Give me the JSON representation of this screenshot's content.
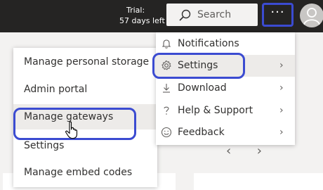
{
  "topbar": {
    "trial_line1": "Trial:",
    "trial_line2": "57 days left",
    "search_label": "Search",
    "more_label": "···"
  },
  "right_menu": {
    "items": [
      {
        "label": "Notifications",
        "icon": "bell-icon",
        "chevron": ""
      },
      {
        "label": "Settings",
        "icon": "gear-icon",
        "chevron": "›"
      },
      {
        "label": "Download",
        "icon": "download-icon",
        "chevron": "›"
      },
      {
        "label": "Help & Support",
        "icon": "question-icon",
        "chevron": "›"
      },
      {
        "label": "Feedback",
        "icon": "smiley-icon",
        "chevron": "›"
      }
    ]
  },
  "left_menu": {
    "items": [
      {
        "label": "Manage personal storage"
      },
      {
        "label": "Admin portal"
      },
      {
        "label": "Manage gateways"
      },
      {
        "label": "Settings"
      },
      {
        "label": "Manage embed codes"
      }
    ]
  },
  "nav": {
    "prev": "‹",
    "next": "›"
  },
  "colors": {
    "topbar": "#252423",
    "highlight": "#3b4bd1",
    "hover": "#edebe9"
  }
}
